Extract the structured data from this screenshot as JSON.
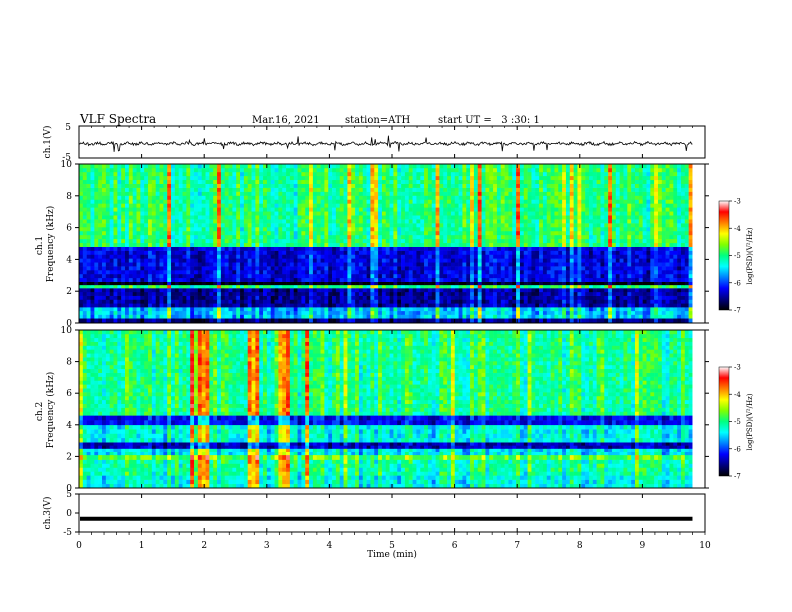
{
  "header": {
    "title": "VLF Spectra",
    "date": "Mar.16, 2021",
    "station": "station=ATH",
    "start": "start UT =   3 :30: 1"
  },
  "chart_data": [
    {
      "type": "line",
      "ylabel": "ch.1(V)",
      "ylim": [
        -5,
        5
      ],
      "y_ticks": [
        "5",
        "-5"
      ],
      "x_range_min": [
        0,
        9.8
      ],
      "description_values": "noisy signal fluctuating near -0.5 V with occasional spikes up to about +1.5 V and down to -2 V"
    },
    {
      "type": "heatmap",
      "ylabel": "ch.1\nFrequency (kHz)",
      "ylim": [
        0,
        10
      ],
      "y_ticks": [
        "0",
        "2",
        "4",
        "6",
        "8",
        "10"
      ],
      "colorbar_label": "log(PSD)(V²/Hz)",
      "colorbar_ticks": [
        "-3",
        "-4",
        "-5",
        "-6",
        "-7"
      ],
      "clim": [
        -7,
        -3
      ],
      "bands": [
        {
          "f_min": 0.0,
          "f_max": 0.3,
          "level": -6.6
        },
        {
          "f_min": 0.3,
          "f_max": 1.0,
          "level": -5.6
        },
        {
          "f_min": 1.0,
          "f_max": 2.2,
          "level": -6.5
        },
        {
          "f_min": 2.2,
          "f_max": 2.4,
          "level": -5.0
        },
        {
          "f_min": 2.4,
          "f_max": 2.6,
          "level": -7.0
        },
        {
          "f_min": 2.6,
          "f_max": 4.8,
          "level": -6.3
        },
        {
          "f_min": 4.8,
          "f_max": 10.0,
          "level": -5.0
        }
      ]
    },
    {
      "type": "heatmap",
      "ylabel": "ch.2\nFrequency (kHz)",
      "ylim": [
        0,
        10
      ],
      "y_ticks": [
        "0",
        "2",
        "4",
        "6",
        "8",
        "10"
      ],
      "colorbar_label": "log(PSD)(V²/Hz)",
      "colorbar_ticks": [
        "-3",
        "-4",
        "-5",
        "-6",
        "-7"
      ],
      "clim": [
        -7,
        -3
      ],
      "bands": [
        {
          "f_min": 0.0,
          "f_max": 0.8,
          "level": -5.3
        },
        {
          "f_min": 0.8,
          "f_max": 1.8,
          "level": -5.1
        },
        {
          "f_min": 1.8,
          "f_max": 2.1,
          "level": -4.7
        },
        {
          "f_min": 2.1,
          "f_max": 2.5,
          "level": -5.4
        },
        {
          "f_min": 2.5,
          "f_max": 2.9,
          "level": -6.4
        },
        {
          "f_min": 2.9,
          "f_max": 4.0,
          "level": -5.3
        },
        {
          "f_min": 4.0,
          "f_max": 4.6,
          "level": -6.2
        },
        {
          "f_min": 4.6,
          "f_max": 10.0,
          "level": -5.0
        }
      ]
    },
    {
      "type": "line",
      "ylabel": "ch.3(V)",
      "ylim": [
        -5,
        5
      ],
      "y_ticks": [
        "5",
        "0",
        "-5"
      ],
      "constant_value": -1.5
    }
  ],
  "x_axis": {
    "label": "Time (min)",
    "ticks": [
      "0",
      "1",
      "2",
      "3",
      "4",
      "5",
      "6",
      "7",
      "8",
      "9",
      "10"
    ],
    "range": [
      0,
      10
    ],
    "data_end": 9.8
  },
  "colors": {
    "colormap": [
      "#000000",
      "#00007f",
      "#0000ff",
      "#0080ff",
      "#00ffff",
      "#00ff80",
      "#80ff00",
      "#ffff00",
      "#ff8000",
      "#ff0000",
      "#ffffff"
    ]
  }
}
